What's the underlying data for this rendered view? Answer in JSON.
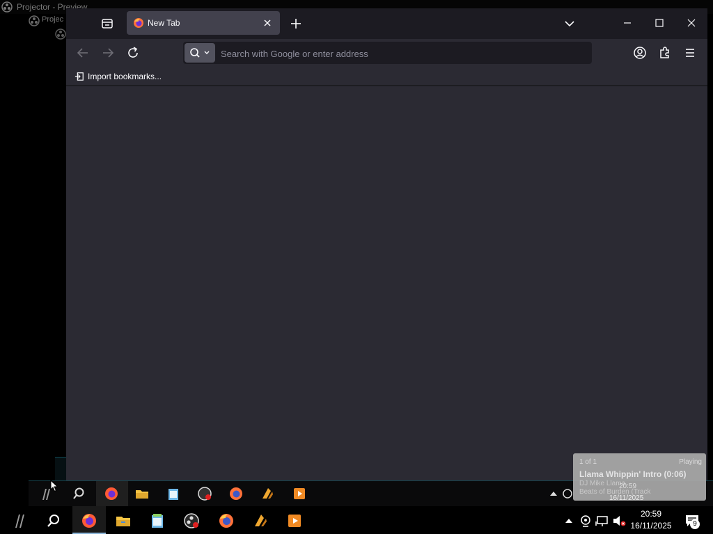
{
  "projector": {
    "title": "Projector - Preview",
    "sub_title": "Projec"
  },
  "browser": {
    "tab": {
      "title": "New Tab"
    },
    "address_bar": {
      "placeholder": "Search with Google or enter address",
      "value": ""
    },
    "bookmarks_bar": {
      "import_label": "Import bookmarks..."
    }
  },
  "media_notification": {
    "count": "1 of 1",
    "status": "Playing",
    "title": "Llama Whippin' Intro (0:06)",
    "artist": "DJ Mike Llama",
    "album": "Beats of Burden (Track",
    "time_overlay": "20:59",
    "date_overlay": "16/11/2025"
  },
  "taskbar": {
    "clock_time": "20:59",
    "clock_date": "16/11/2025",
    "notification_count": "9",
    "apps": [
      "firefox-nightly",
      "file-explorer",
      "notepad",
      "obs-studio",
      "firefox",
      "winamp",
      "media-player"
    ]
  },
  "colors": {
    "browser_bg": "#2b2a33",
    "tabbar_bg": "#1c1b22",
    "active_tab": "#42414d",
    "taskbar_bg": "#000000"
  }
}
